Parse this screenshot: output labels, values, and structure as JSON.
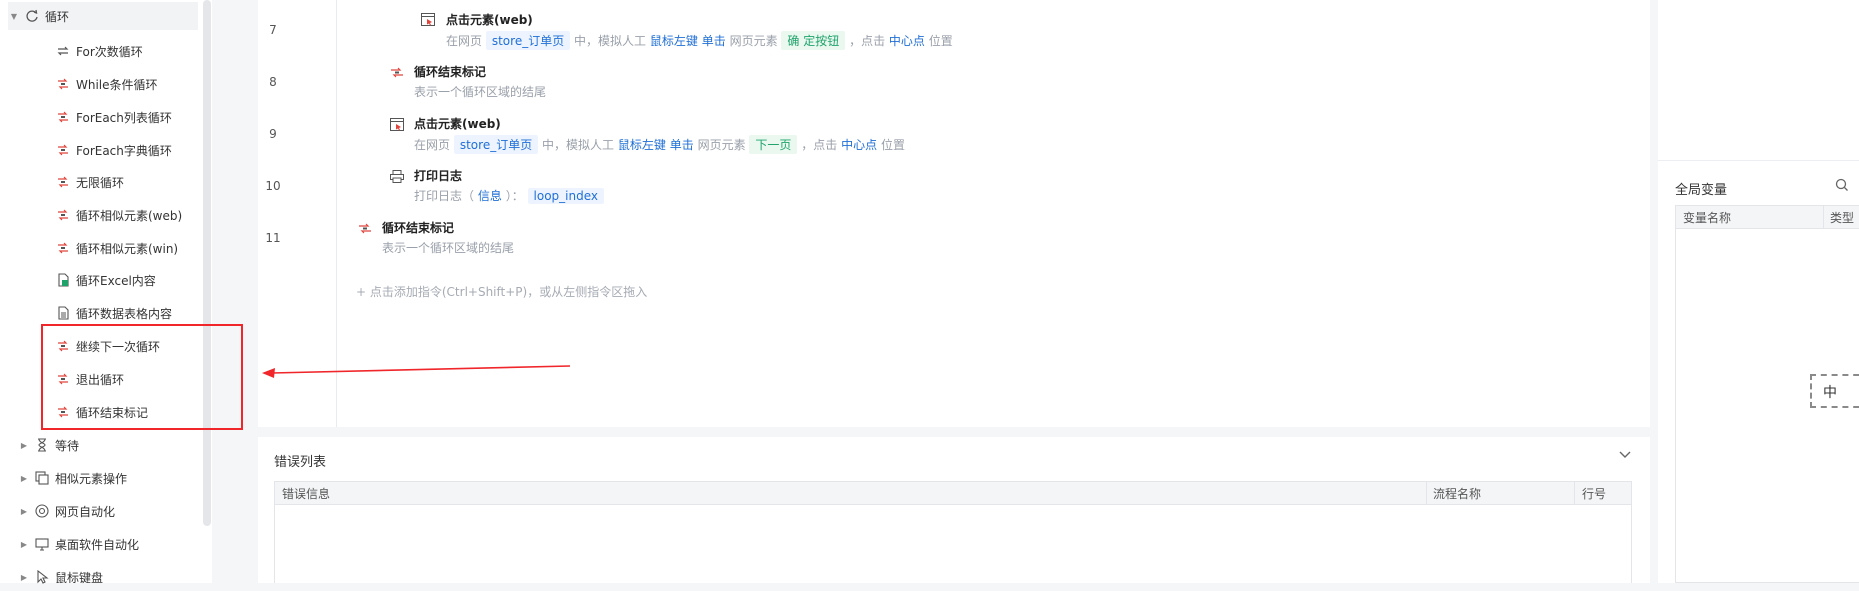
{
  "sidebar": {
    "group_loop": "循环",
    "items": [
      "For次数循环",
      "While条件循环",
      "ForEach列表循环",
      "ForEach字典循环",
      "无限循环",
      "循环相似元素(web)",
      "循环相似元素(win)",
      "循环Excel内容",
      "循环数据表格内容",
      "继续下一次循环",
      "退出循环",
      "循环结束标记"
    ],
    "groups": [
      "等待",
      "相似元素操作",
      "网页自动化",
      "桌面软件自动化",
      "鼠标键盘"
    ]
  },
  "editor": {
    "line_numbers": [
      "7",
      "8",
      "9",
      "10",
      "11"
    ],
    "step7": {
      "title": "点击元素(web)",
      "pre": "在网页",
      "page": "store_订单页",
      "mid1": "中，模拟人工",
      "btn": "鼠标左键",
      "click": "单击",
      "mid2": "网页元素",
      "elem": "确 定按钮",
      "mid3": "，点击",
      "pos": "中心点",
      "post": "位置"
    },
    "step8": {
      "title": "循环结束标记",
      "desc": "表示一个循环区域的结尾"
    },
    "step9": {
      "title": "点击元素(web)",
      "pre": "在网页",
      "page": "store_订单页",
      "mid1": "中，模拟人工",
      "btn": "鼠标左键",
      "click": "单击",
      "mid2": "网页元素",
      "elem": "下一页",
      "mid3": "，点击",
      "pos": "中心点",
      "post": "位置"
    },
    "step10": {
      "title": "打印日志",
      "pre": "打印日志（",
      "level": "信息",
      "post": "）：",
      "var": "loop_index"
    },
    "step11": {
      "title": "循环结束标记",
      "desc": "表示一个循环区域的结尾"
    },
    "add_hint": "+ 点击添加指令(Ctrl+Shift+P)，或从左侧指令区拖入"
  },
  "error_panel": {
    "title": "错误列表",
    "columns": [
      "错误信息",
      "流程名称",
      "行号"
    ]
  },
  "right_panel": {
    "title": "全局变量",
    "columns": [
      "变量名称",
      "类型"
    ],
    "ime_char": "中"
  },
  "colors": {
    "highlight": "#f0262a",
    "link": "#1f6fd6",
    "chip_green": "#20a36b"
  }
}
